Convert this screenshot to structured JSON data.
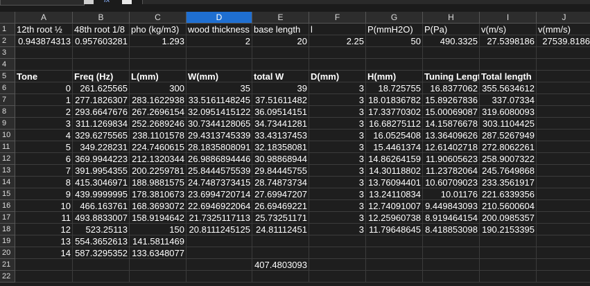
{
  "toolbar": {
    "fx_label": "fx"
  },
  "columns": [
    "A",
    "B",
    "C",
    "D",
    "E",
    "F",
    "G",
    "H",
    "I",
    "J"
  ],
  "selected_column": "D",
  "rows": [
    "1",
    "2",
    "3",
    "4",
    "5",
    "6",
    "7",
    "8",
    "9",
    "10",
    "11",
    "12",
    "13",
    "14",
    "15",
    "16",
    "17",
    "18",
    "19",
    "20",
    "21",
    "22"
  ],
  "row1": [
    "12th root ½",
    "48th root 1/8",
    "pho (kg/m3)",
    "wood thickness",
    "base length",
    "l",
    "P(mmH2O)",
    "P(Pa)",
    "v(m/s)",
    "v(mm/s)"
  ],
  "row2": [
    "0.943874313",
    "0.957603281",
    "1.293",
    "2",
    "20",
    "2.25",
    "50",
    "490.3325",
    "27.5398186",
    "27539.8186"
  ],
  "row5": [
    "Tone",
    "Freq (Hz)",
    "L(mm)",
    "W(mm)",
    "total W",
    "D(mm)",
    "H(mm)",
    "Tuning Length",
    "Total length",
    ""
  ],
  "table": [
    [
      "0",
      "261.625565",
      "300",
      "35",
      "39",
      "3",
      "18.725755",
      "16.8377062",
      "355.5634612"
    ],
    [
      "1",
      "277.1826307",
      "283.1622938",
      "33.5161148245",
      "37.51611482",
      "3",
      "18.01836782",
      "15.89267836",
      "337.07334"
    ],
    [
      "2",
      "293.6647676",
      "267.2696154",
      "32.0951415122",
      "36.09514151",
      "3",
      "17.33770302",
      "15.00069087",
      "319.6080093"
    ],
    [
      "3",
      "311.1269834",
      "252.2689246",
      "30.7344128065",
      "34.73441281",
      "3",
      "16.68275112",
      "14.15876678",
      "303.1104425"
    ],
    [
      "4",
      "329.6275565",
      "238.1101578",
      "29.4313745339",
      "33.43137453",
      "3",
      "16.0525408",
      "13.36409626",
      "287.5267949"
    ],
    [
      "5",
      "349.228231",
      "224.7460615",
      "28.1835808091",
      "32.18358081",
      "3",
      "15.4461374",
      "12.61402718",
      "272.8062261"
    ],
    [
      "6",
      "369.9944223",
      "212.1320344",
      "26.9886894446",
      "30.98868944",
      "3",
      "14.86264159",
      "11.90605623",
      "258.9007322"
    ],
    [
      "7",
      "391.9954355",
      "200.2259781",
      "25.8444575539",
      "29.84445755",
      "3",
      "14.30118802",
      "11.23782064",
      "245.7649868"
    ],
    [
      "8",
      "415.3046971",
      "188.9881575",
      "24.7487373415",
      "28.74873734",
      "3",
      "13.76094401",
      "10.60709023",
      "233.3561917"
    ],
    [
      "9",
      "439.9999995",
      "178.3810673",
      "23.6994720714",
      "27.69947207",
      "3",
      "13.24110834",
      "10.01176",
      "221.6339356"
    ],
    [
      "10",
      "466.163761",
      "168.3693072",
      "22.6946922064",
      "26.69469221",
      "3",
      "12.74091007",
      "9.449843093",
      "210.5600604"
    ],
    [
      "11",
      "493.8833007",
      "158.9194642",
      "21.7325117113",
      "25.73251171",
      "3",
      "12.25960738",
      "8.919464154",
      "200.0985357"
    ],
    [
      "12",
      "523.25113",
      "150",
      "20.8111245125",
      "24.81112451",
      "3",
      "11.79648645",
      "8.418853098",
      "190.2153395"
    ],
    [
      "13",
      "554.3652613",
      "141.5811469",
      "",
      "",
      "",
      "",
      "",
      "",
      ""
    ],
    [
      "14",
      "587.3295352",
      "133.6348077",
      "",
      "",
      "",
      "",
      "",
      "",
      ""
    ]
  ],
  "row21_e": "407.4803093"
}
